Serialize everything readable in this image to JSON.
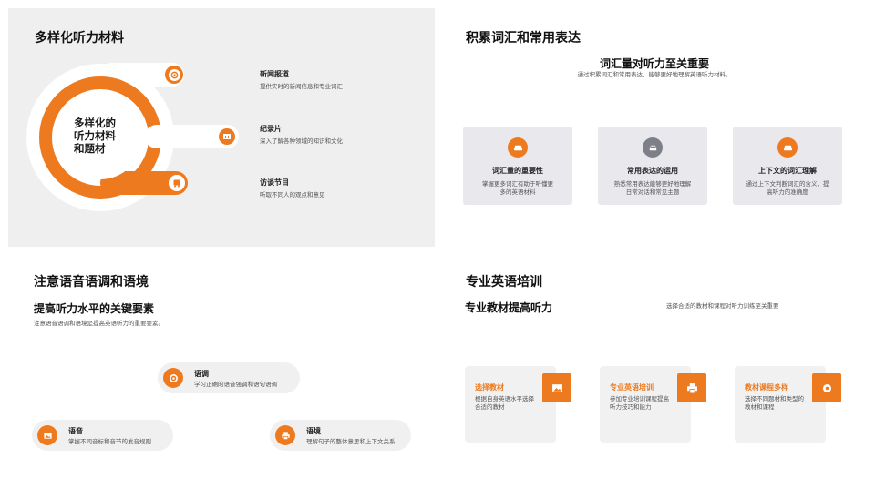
{
  "colors": {
    "accent": "#ee7a1f",
    "gray_icon": "#7d8088",
    "panel": "#efefef"
  },
  "slide1": {
    "title": "多样化听力材料",
    "center_text": "多样化的\n听力材料\n和题材",
    "items": [
      {
        "label": "新闻报道",
        "desc": "提供实时的新闻信息和专业词汇",
        "icon": "target-icon"
      },
      {
        "label": "纪录片",
        "desc": "深入了解各种领域的知识和文化",
        "icon": "book-icon"
      },
      {
        "label": "访谈节目",
        "desc": "听取不同人的观点和意见",
        "icon": "bus-icon"
      }
    ]
  },
  "slide2": {
    "title": "积累词汇和常用表达",
    "subtitle": "词汇量对听力至关重要",
    "intro": "通过积累词汇和常用表达，能够更好地理解英语听力材料。",
    "cards": [
      {
        "title": "词汇量的重要性",
        "desc": "掌握更多词汇有助于听懂更多的英语材料",
        "icon": "couch-icon",
        "icon_color": "#ee7a1f"
      },
      {
        "title": "常用表达的运用",
        "desc": "熟悉常用表达能够更好地理解日常对话和常见主题",
        "icon": "car-icon",
        "icon_color": "#7d8088"
      },
      {
        "title": "上下文的词汇理解",
        "desc": "通过上下文判断词汇的含义，提高听力的准确度",
        "icon": "couch-icon",
        "icon_color": "#ee7a1f"
      }
    ]
  },
  "slide3": {
    "title": "注意语音语调和语境",
    "subtitle": "提高听力水平的关键要素",
    "intro": "注意语音语调和语境是提高英语听力的重要要素。",
    "items": [
      {
        "label": "语调",
        "desc": "学习正确的语音强调和语句语调",
        "icon": "target-icon"
      },
      {
        "label": "语音",
        "desc": "掌握不同音标和音节的发音规则",
        "icon": "image-icon"
      },
      {
        "label": "语境",
        "desc": "理解句子的整体意思和上下文关系",
        "icon": "printer-icon"
      }
    ]
  },
  "slide4": {
    "title": "专业英语培训",
    "subtitle": "专业教材提高听力",
    "intro": "选择合适的教材和课程对听力训练至关重要",
    "cards": [
      {
        "title": "选择教材",
        "desc": "根据自身英语水平选择合适的教材",
        "icon": "image-icon"
      },
      {
        "title": "专业英语培训",
        "desc": "参加专业培训课程提高听力技巧和能力",
        "icon": "printer-icon"
      },
      {
        "title": "教材课程多样",
        "desc": "选择不同题材和类型的教材和课程",
        "icon": "target-icon"
      }
    ]
  }
}
